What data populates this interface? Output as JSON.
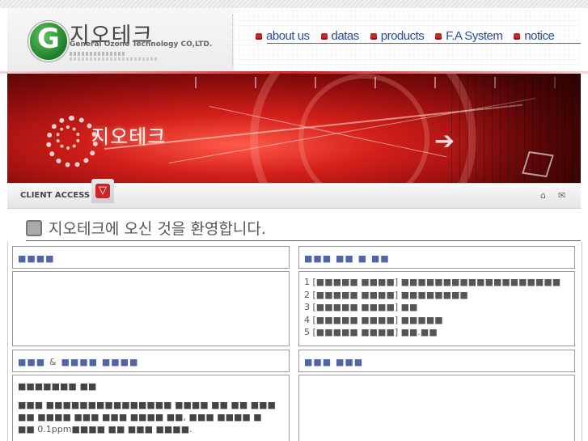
{
  "header": {
    "logo_letter": "G",
    "company_korean": "지오테크",
    "company_english": "General Ozone Technology CO,LTD.",
    "nav": [
      {
        "label": "about us"
      },
      {
        "label": "datas"
      },
      {
        "label": "products"
      },
      {
        "label": "F.A System"
      },
      {
        "label": "notice"
      }
    ]
  },
  "banner": {
    "title": "지오테크"
  },
  "client_bar": {
    "label": "CLIENT ACCESS",
    "button_glyph": "▽",
    "home_glyph": "⌂",
    "mail_glyph": "✉"
  },
  "welcome": {
    "text": "지오테크에 오신 것을 환영합니다."
  },
  "panels": {
    "left_top_title": "■■■■",
    "right_top_title": "■■■ ■■ ■ ■■",
    "left_bottom_title_a": "■■■",
    "left_bottom_title_amp": "&",
    "left_bottom_title_b": "■■■■ ■■■■",
    "right_bottom_title": "■■■ ■■■",
    "news": [
      {
        "num": "1",
        "tag": "■■■■■ ■■■■",
        "text": "■■■■■■■■■■■■■■■■■■■"
      },
      {
        "num": "2",
        "tag": "■■■■■ ■■■■",
        "text": "■■■■■■■■"
      },
      {
        "num": "3",
        "tag": "■■■■■ ■■■■",
        "text": "■■"
      },
      {
        "num": "4",
        "tag": "■■■■■ ■■■■",
        "text": "■■■■■"
      },
      {
        "num": "5",
        "tag": "■■■■■ ■■■■",
        "text": "■■.■■"
      }
    ],
    "body_heading": "■■■■■■■ ■■",
    "body_line1": "■■■ ■■■■■■■■■■■■■■■ ■■■■ ■■ ■■ ■■■",
    "body_line2": "■■ ■■■■ ■■■ ■■■ ■■■■ ■■, ■■■ ■■■■ ■",
    "body_line3_a": "■■",
    "body_line3_ppm": "0.1ppm",
    "body_line3_b": "■■■■ ■■ ■■■ ■■■■."
  }
}
